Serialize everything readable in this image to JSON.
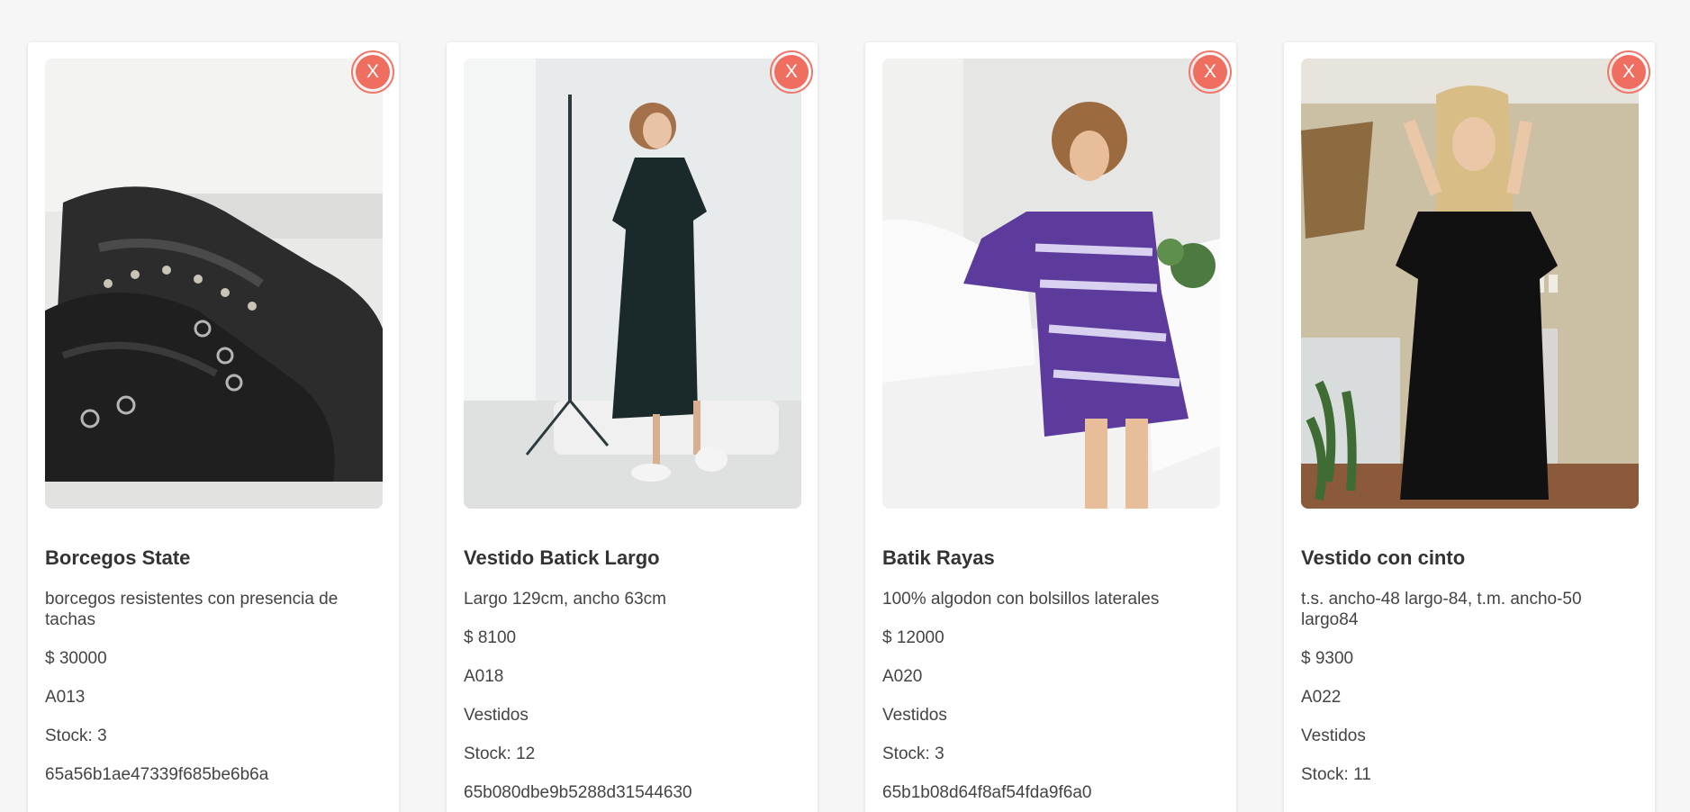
{
  "close_label": "X",
  "products": [
    {
      "title": "Borcegos State",
      "description": "borcegos resistentes con presencia de tachas",
      "price": "$ 30000",
      "code": "A013",
      "stock": "Stock: 3",
      "id": "65a56b1ae47339f685be6b6a"
    },
    {
      "title": "Vestido Batick Largo",
      "description": "Largo 129cm, ancho 63cm",
      "price": "$ 8100",
      "code": "A018",
      "category": "Vestidos",
      "stock": "Stock: 12",
      "id": "65b080dbe9b5288d31544630"
    },
    {
      "title": "Batik Rayas",
      "description": "100% algodon con bolsillos laterales",
      "price": "$ 12000",
      "code": "A020",
      "category": "Vestidos",
      "stock": "Stock: 3",
      "id": "65b1b08d64f8af54fda9f6a0"
    },
    {
      "title": "Vestido con cinto",
      "description": "t.s. ancho-48 largo-84, t.m. ancho-50 largo84",
      "price": "$ 9300",
      "code": "A022",
      "category": "Vestidos",
      "stock": "Stock: 11"
    }
  ]
}
